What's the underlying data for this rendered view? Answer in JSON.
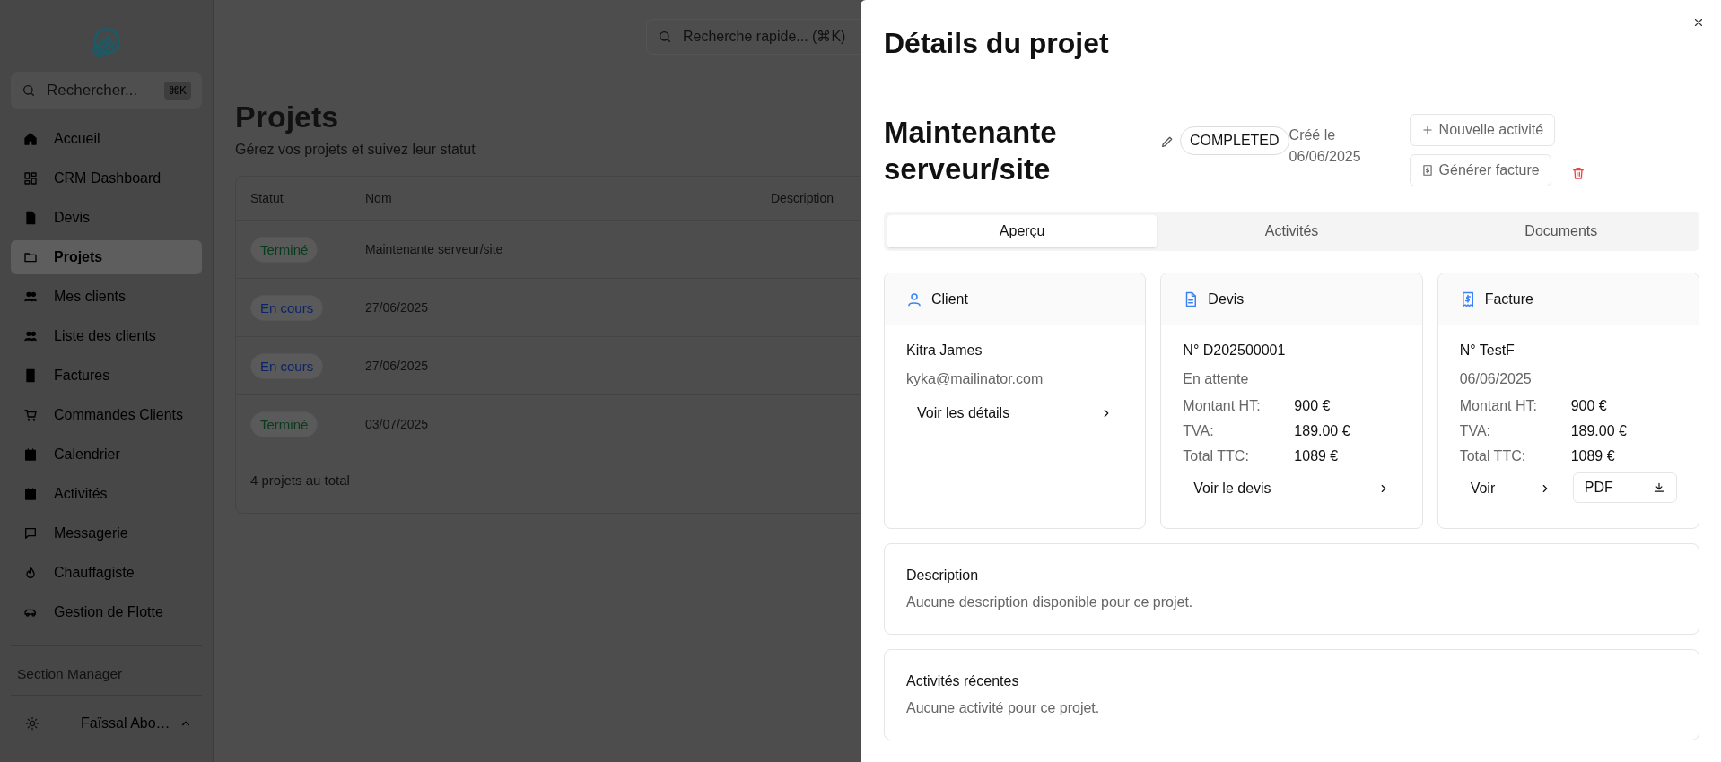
{
  "sidebar": {
    "search": {
      "placeholder": "Rechercher...",
      "shortcut": "⌘K"
    },
    "items": [
      {
        "label": "Accueil",
        "selected": false
      },
      {
        "label": "CRM Dashboard",
        "selected": false
      },
      {
        "label": "Devis",
        "selected": false
      },
      {
        "label": "Projets",
        "selected": true
      },
      {
        "label": "Mes clients",
        "selected": false
      },
      {
        "label": "Liste des clients",
        "selected": false
      },
      {
        "label": "Factures",
        "selected": false
      },
      {
        "label": "Commandes Clients",
        "selected": false
      },
      {
        "label": "Calendrier",
        "selected": false
      },
      {
        "label": "Activités",
        "selected": false
      },
      {
        "label": "Messagerie",
        "selected": false
      },
      {
        "label": "Chauffagiste",
        "selected": false
      },
      {
        "label": "Gestion de Flotte",
        "selected": false
      }
    ],
    "section": "Section Manager",
    "user": {
      "name": "Faïssal Abo…"
    }
  },
  "topbar": {
    "search": {
      "placeholder": "Recherche rapide... (⌘K)"
    }
  },
  "page": {
    "title": "Projets",
    "subtitle": "Gérez vos projets et suivez leur statut",
    "table": {
      "columns": [
        "Statut",
        "Nom",
        "Description"
      ],
      "rows": [
        {
          "status": "Terminé",
          "color": "#0a3a1e",
          "name": "Maintenante serveur/site"
        },
        {
          "status": "En cours",
          "color": "#0c2466",
          "name": "27/06/2025"
        },
        {
          "status": "En cours",
          "color": "#0c2466",
          "name": "27/06/2025"
        },
        {
          "status": "Terminé",
          "color": "#0a3a1e",
          "name": "03/07/2025"
        }
      ],
      "footer": "4 projets au total"
    }
  },
  "panel": {
    "title": "Détails du projet",
    "project": {
      "name": "Maintenante serveur/site",
      "status": "COMPLETED",
      "created": "Créé le 06/06/2025"
    },
    "actions": [
      {
        "label": "Nouvelle activité"
      },
      {
        "label": "Générer facture"
      }
    ],
    "tabs": [
      {
        "label": "Aperçu",
        "selected": true
      },
      {
        "label": "Activités",
        "selected": false
      },
      {
        "label": "Documents",
        "selected": false
      }
    ],
    "cards": [
      {
        "title": "Client",
        "primary": "Kitra James",
        "secondary": "kyka@mailinator.com",
        "link": "Voir les détails"
      },
      {
        "title": "Devis",
        "primary": "N° D202500001",
        "secondary": "En attente",
        "amounts": [
          {
            "label": "Montant HT:",
            "value": "900 €"
          },
          {
            "label": "TVA:",
            "value": "189.00 €"
          },
          {
            "label": "Total TTC:",
            "value": "1089 €"
          }
        ],
        "link": "Voir le devis"
      },
      {
        "title": "Facture",
        "primary": "N° TestF",
        "secondary": "06/06/2025",
        "amounts": [
          {
            "label": "Montant HT:",
            "value": "900 €"
          },
          {
            "label": "TVA:",
            "value": "189.00 €"
          },
          {
            "label": "Total TTC:",
            "value": "1089 €"
          }
        ],
        "link": "Voir",
        "pdf": "PDF"
      }
    ],
    "sections": [
      {
        "title": "Description",
        "text": "Aucune description disponible pour ce projet."
      },
      {
        "title": "Activités récentes",
        "text": "Aucune activité pour ce projet."
      }
    ]
  }
}
